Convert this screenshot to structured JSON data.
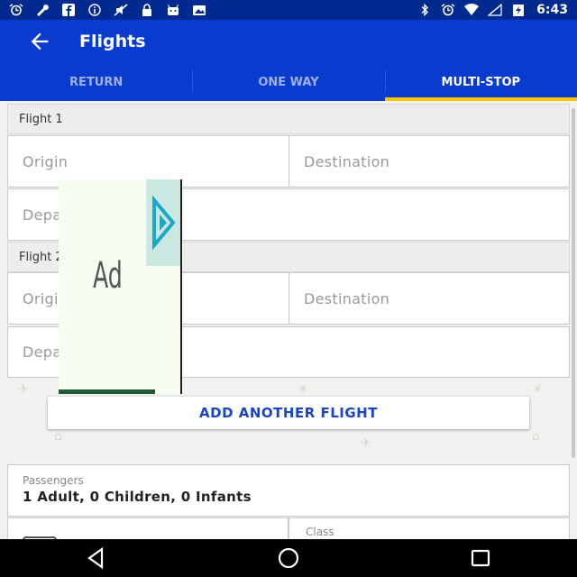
{
  "status_bar": {
    "time": "6:43",
    "icons": [
      "alarm-icon",
      "wrench-icon",
      "facebook-icon",
      "info-icon",
      "mute-icon",
      "lock-icon",
      "android-icon",
      "photo-icon",
      "bluetooth-icon",
      "alarm-icon",
      "wifi-icon",
      "signal-icon",
      "battery-icon"
    ]
  },
  "app_bar": {
    "title": "Flights",
    "back_icon": "arrow-left-icon"
  },
  "tabs": [
    {
      "label": "RETURN",
      "active": false
    },
    {
      "label": "ONE WAY",
      "active": false
    },
    {
      "label": "MULTI-STOP",
      "active": true
    }
  ],
  "flights": [
    {
      "header": "Flight 1",
      "origin_placeholder": "Origin",
      "destination_placeholder": "Destination",
      "departure_placeholder": "Departure Date"
    },
    {
      "header": "Flight 2",
      "origin_placeholder": "Origin",
      "destination_placeholder": "Destination",
      "departure_placeholder": "Departure Date"
    }
  ],
  "add_flight_label": "ADD ANOTHER FLIGHT",
  "passengers": {
    "label": "Passengers",
    "value": "1 Adult, 0 Children, 0 Infants"
  },
  "class": {
    "label": "Class"
  },
  "ad": {
    "text": "Ad"
  },
  "colors": {
    "app_bar": "#0a3bcf",
    "status_bar": "#002a8f",
    "tab_indicator": "#ffc400",
    "accent_text": "#1a44c9"
  }
}
